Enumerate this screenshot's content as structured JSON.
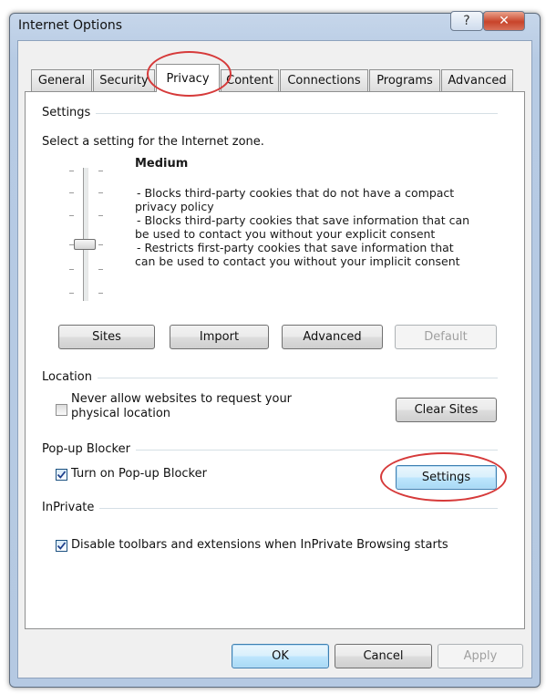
{
  "window": {
    "title": "Internet Options",
    "help_glyph": "?",
    "close_glyph": "✕"
  },
  "tabs": [
    {
      "label": "General",
      "active": false
    },
    {
      "label": "Security",
      "active": false
    },
    {
      "label": "Privacy",
      "active": true
    },
    {
      "label": "Content",
      "active": false
    },
    {
      "label": "Connections",
      "active": false
    },
    {
      "label": "Programs",
      "active": false
    },
    {
      "label": "Advanced",
      "active": false
    }
  ],
  "settings": {
    "group_label": "Settings",
    "instruction": "Select a setting for the Internet zone.",
    "level_title": "Medium",
    "description_lines": [
      "- Blocks third-party cookies that do not have a compact",
      "privacy policy",
      "- Blocks third-party cookies that save information that can",
      "be used to contact you without your explicit consent",
      "- Restricts first-party cookies that save information that",
      "can be used to contact you without your implicit consent"
    ],
    "buttons": {
      "sites": "Sites",
      "import": "Import",
      "advanced": "Advanced",
      "default": "Default"
    }
  },
  "location": {
    "group_label": "Location",
    "checkbox_line1": "Never allow websites to request your",
    "checkbox_line2": "physical location",
    "checked": false,
    "clear_sites_button": "Clear Sites"
  },
  "popup_blocker": {
    "group_label": "Pop-up Blocker",
    "checkbox_label": "Turn on Pop-up Blocker",
    "checked": true,
    "settings_button": "Settings"
  },
  "inprivate": {
    "group_label": "InPrivate",
    "checkbox_label": "Disable toolbars and extensions when InPrivate Browsing starts",
    "checked": true
  },
  "footer": {
    "ok": "OK",
    "cancel": "Cancel",
    "apply": "Apply"
  },
  "colors": {
    "annotation_circle": "#d63a3a",
    "title_bar": "#b7cbe4"
  }
}
